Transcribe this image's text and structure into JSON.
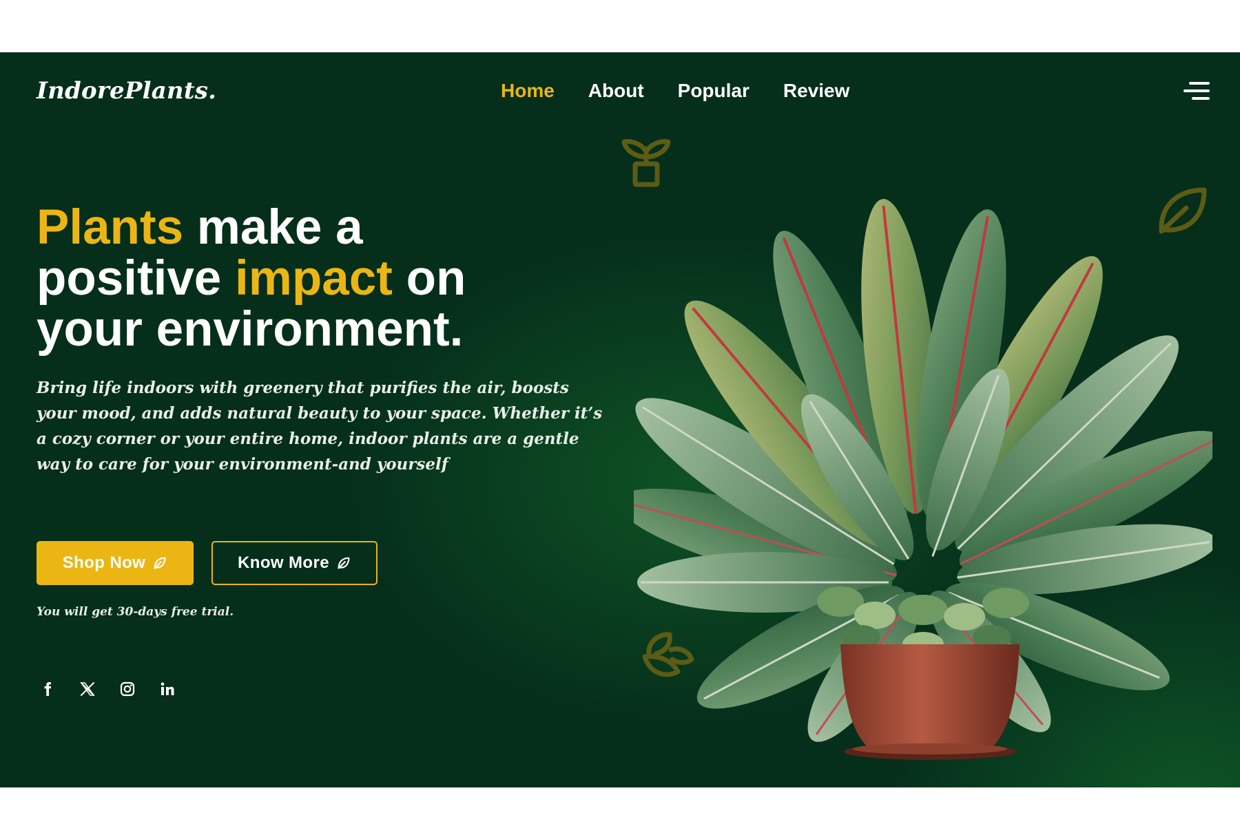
{
  "brand": {
    "logo_text": "IndorePlants."
  },
  "nav": {
    "items": [
      {
        "label": "Home",
        "active": true
      },
      {
        "label": "About",
        "active": false
      },
      {
        "label": "Popular",
        "active": false
      },
      {
        "label": "Review",
        "active": false
      }
    ],
    "menu_icon": "hamburger-menu-icon"
  },
  "hero": {
    "title_word_1": "Plants",
    "title_text_1": " make a",
    "title_text_2": "positive ",
    "title_word_2": "impact",
    "title_text_3": " on",
    "title_text_4": "your environment.",
    "description": "Bring life indoors with greenery that purifies the air, boosts your mood, and adds natural beauty to your space. Whether it’s a cozy corner or your entire home, indoor plants are a gentle way to care for your environment-and yourself",
    "shop_button": "Shop Now",
    "know_button": "Know More",
    "trial_note": "You will get 30-days free trial."
  },
  "socials": [
    {
      "icon": "facebook-icon"
    },
    {
      "icon": "x-twitter-icon"
    },
    {
      "icon": "instagram-icon"
    },
    {
      "icon": "linkedin-icon"
    }
  ],
  "colors": {
    "background": "#052e1b",
    "accent": "#ebb614",
    "text": "#ffffff"
  }
}
